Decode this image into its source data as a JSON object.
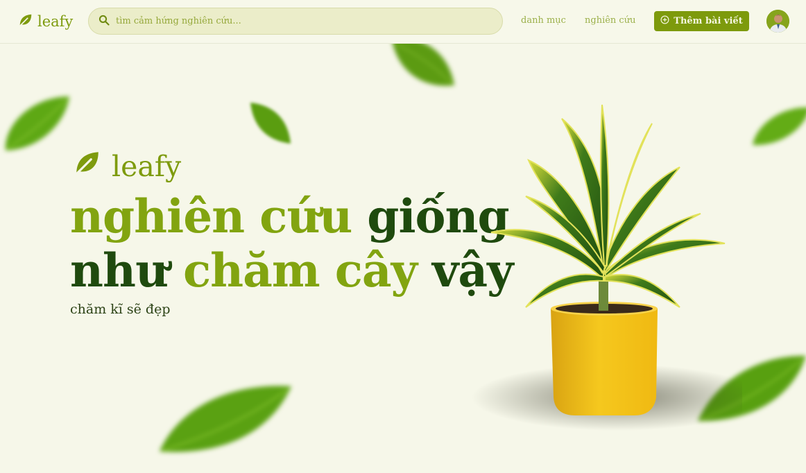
{
  "header": {
    "brand": "leafy",
    "search_placeholder": "tìm cảm hứng nghiên cứu...",
    "nav": {
      "categories": "danh mục",
      "research": "nghiên cứu"
    },
    "add_post_label": "Thêm bài viết"
  },
  "hero": {
    "brand": "leafy",
    "headline": {
      "part1": "nghiên cứu",
      "part2": "giống",
      "part3": "như",
      "part4": "chăm cây",
      "part5": "vậy"
    },
    "tagline": "chăm kĩ sẽ đẹp"
  },
  "colors": {
    "background": "#f6f7e9",
    "accent": "#7d9a0c",
    "dark_green": "#1f4a0e",
    "light_green": "#82a410",
    "pot_yellow": "#f3c21a"
  },
  "icons": {
    "brand": "leaf-icon",
    "search": "search-icon",
    "add": "plus-circle-icon"
  }
}
